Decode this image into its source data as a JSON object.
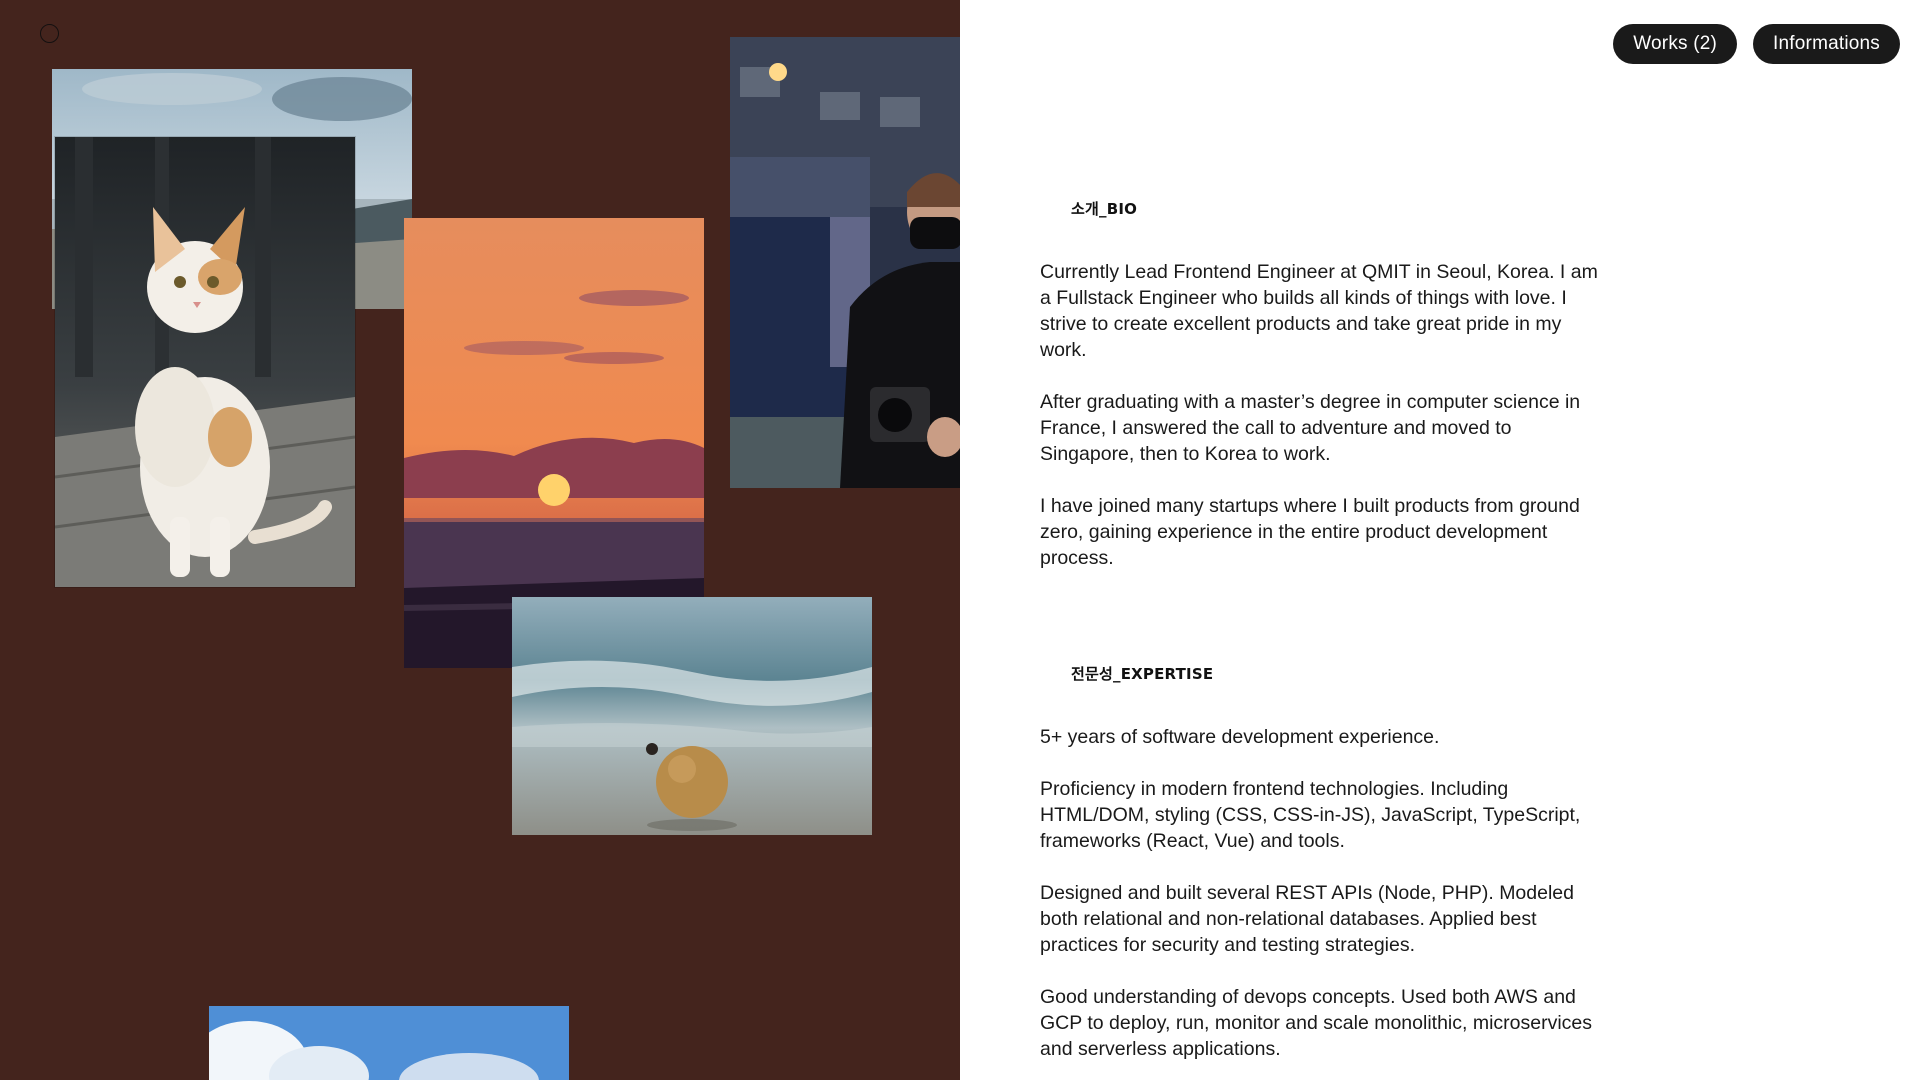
{
  "nav": {
    "works_label": "Works (2)",
    "informations_label": "Informations"
  },
  "bio": {
    "title": "소개_BIO",
    "paragraphs": [
      "Currently Lead Frontend Engineer at QMIT in Seoul, Korea. I am a Fullstack Engineer who builds all kinds of things with love. I strive to create excellent products and take great pride in my work.",
      "After graduating with a master’s degree in computer science in France, I answered the call to adventure and moved to Singapore, then to Korea to work.",
      "I have joined many startups where I built products from ground zero, gaining experience in the entire product development process."
    ]
  },
  "expertise": {
    "title": "전문성_EXPERTISE",
    "paragraphs": [
      "5+ years of software development experience.",
      "Proficiency in modern frontend technologies. Including HTML/DOM, styling (CSS, CSS-in-JS), JavaScript, TypeScript, frameworks (React, Vue) and tools.",
      "Designed and built several REST APIs (Node, PHP). Modeled both relational and non-relational databases. Applied best practices for security and testing strategies.",
      "Good understanding of devops concepts. Used both AWS and GCP to deploy, run, monitor and scale monolithic, microservices and serverless applications."
    ]
  },
  "colors": {
    "gallery_background": "#44241d",
    "panel_background": "#ffffff",
    "pill_background": "#1a1a1a",
    "text": "#1a1a1a"
  },
  "icons": {
    "logo": "circle-outline-icon"
  }
}
